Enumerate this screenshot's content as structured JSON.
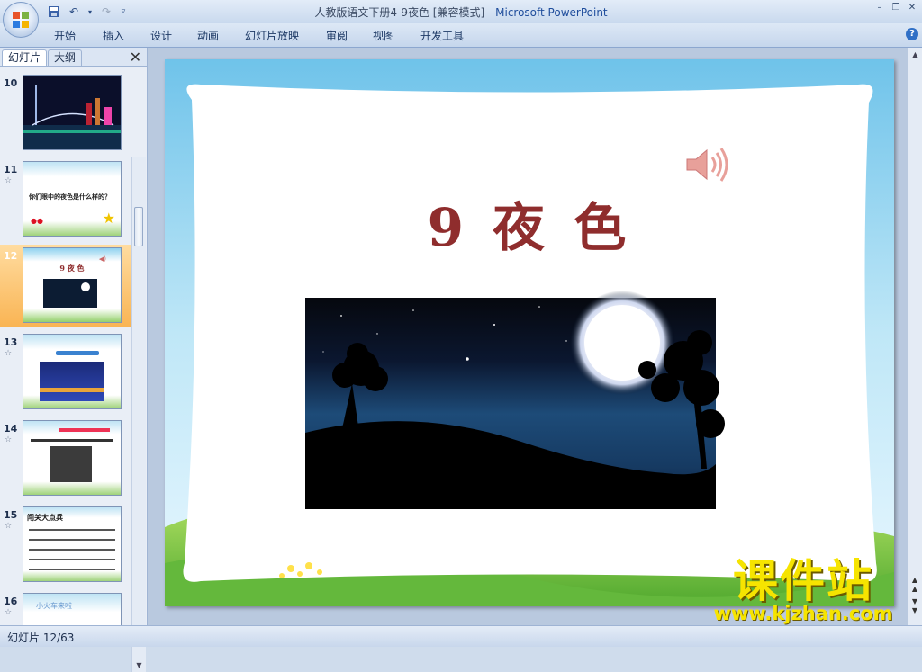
{
  "window": {
    "title_doc": "人教版语文下册4-9夜色 [兼容模式] - ",
    "title_app": "Microsoft PowerPoint"
  },
  "ribbon": {
    "tabs": [
      "开始",
      "插入",
      "设计",
      "动画",
      "幻灯片放映",
      "审阅",
      "视图",
      "开发工具"
    ]
  },
  "left_pane": {
    "tab_slides": "幻灯片",
    "tab_outline": "大纲",
    "thumbnails": [
      {
        "num": "10",
        "star": ""
      },
      {
        "num": "11",
        "star": "☆",
        "caption": "你们眼中的夜色是什么样的？"
      },
      {
        "num": "12",
        "star": "",
        "title": "9 夜 色"
      },
      {
        "num": "13",
        "star": "☆"
      },
      {
        "num": "14",
        "star": "☆"
      },
      {
        "num": "15",
        "star": "☆",
        "title": "闯关大点兵"
      },
      {
        "num": "16",
        "star": "☆",
        "title": "小火车来啦"
      }
    ]
  },
  "slide": {
    "title": "9 夜  色"
  },
  "watermark": {
    "title": "课件站",
    "url": "www.kjzhan.com"
  },
  "status": {
    "slide_counter": "幻灯片 12/63"
  },
  "colors": {
    "title": "#8f2d2d",
    "accent": "#f6e400",
    "selected_thumb": "#f9b453"
  }
}
